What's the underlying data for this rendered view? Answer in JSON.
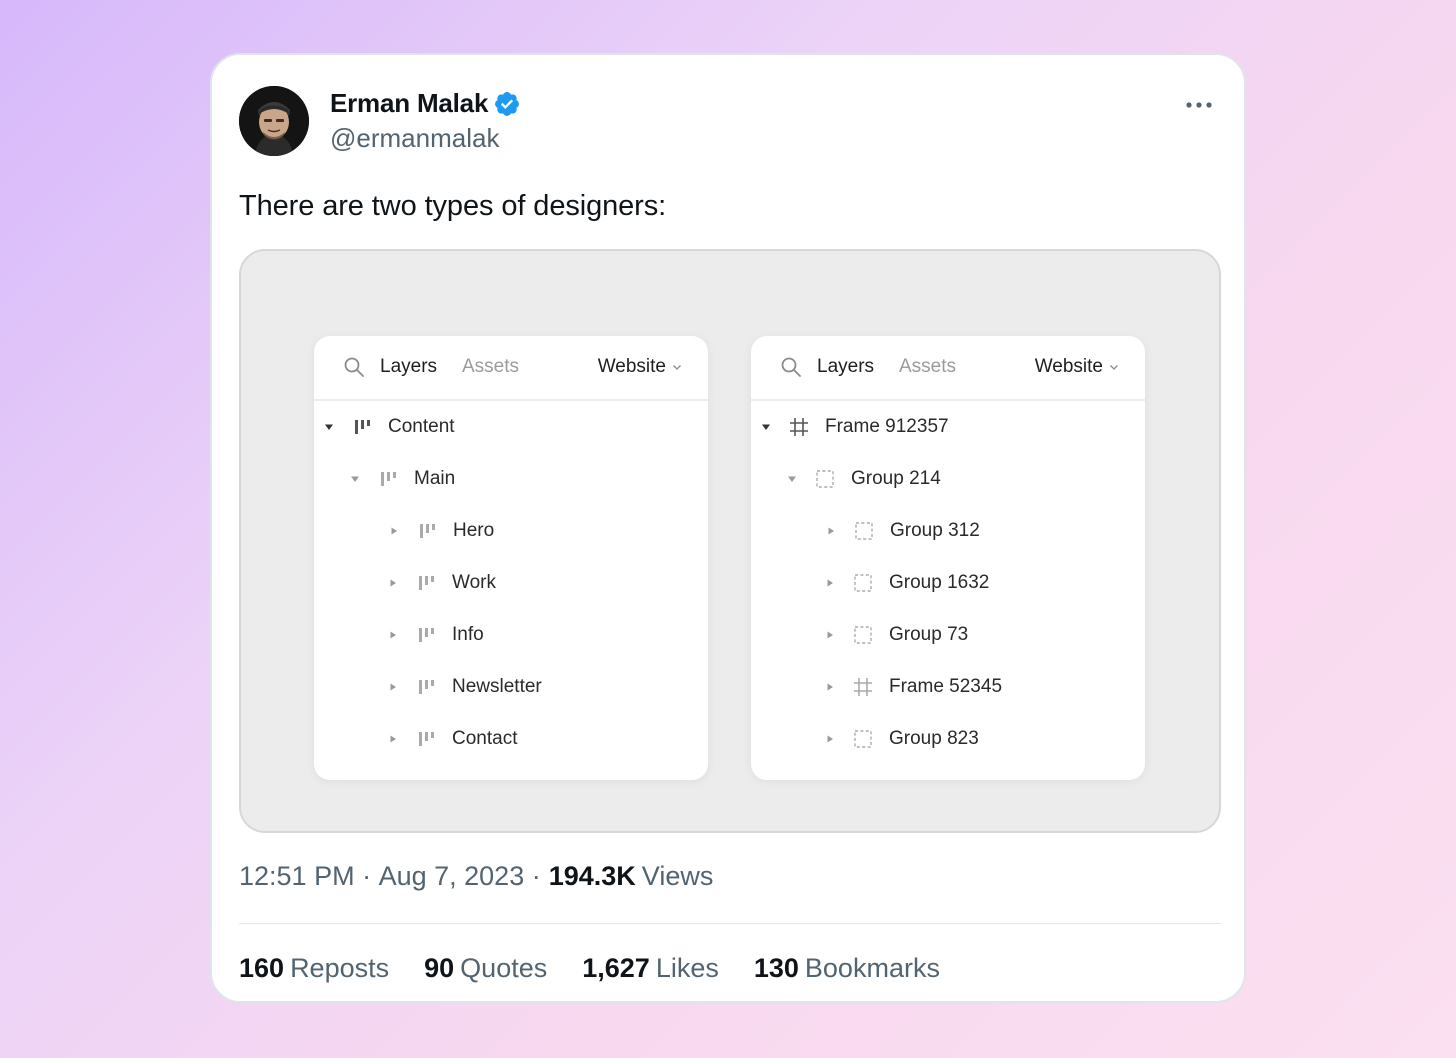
{
  "tweet": {
    "author_name": "Erman Malak",
    "handle": "@ermanmalak",
    "text": "There are two types of designers:",
    "time": "12:51 PM",
    "date": "Aug 7, 2023",
    "views_count": "194.3K",
    "views_label": "Views",
    "stats": [
      {
        "count": "160",
        "label": "Reposts"
      },
      {
        "count": "90",
        "label": "Quotes"
      },
      {
        "count": "1,627",
        "label": "Likes"
      },
      {
        "count": "130",
        "label": "Bookmarks"
      }
    ]
  },
  "panels": [
    {
      "tabs": {
        "layers": "Layers",
        "assets": "Assets",
        "page": "Website"
      },
      "rows": [
        {
          "label": "Content",
          "icon": "auto-layout-icon",
          "expanded": true
        },
        {
          "label": "Main",
          "icon": "auto-layout-icon",
          "expanded": true
        },
        {
          "label": "Hero",
          "icon": "auto-layout-icon",
          "expanded": false
        },
        {
          "label": "Work",
          "icon": "auto-layout-icon",
          "expanded": false
        },
        {
          "label": "Info",
          "icon": "auto-layout-icon",
          "expanded": false
        },
        {
          "label": "Newsletter",
          "icon": "auto-layout-icon",
          "expanded": false
        },
        {
          "label": "Contact",
          "icon": "auto-layout-icon",
          "expanded": false
        }
      ]
    },
    {
      "tabs": {
        "layers": "Layers",
        "assets": "Assets",
        "page": "Website"
      },
      "rows": [
        {
          "label": "Frame 912357",
          "icon": "frame-icon",
          "expanded": true
        },
        {
          "label": "Group 214",
          "icon": "group-icon",
          "expanded": true
        },
        {
          "label": "Group 312",
          "icon": "group-icon",
          "expanded": false
        },
        {
          "label": "Group 1632",
          "icon": "group-icon",
          "expanded": false
        },
        {
          "label": "Group 73",
          "icon": "group-icon",
          "expanded": false
        },
        {
          "label": "Frame 52345",
          "icon": "frame-icon",
          "expanded": false
        },
        {
          "label": "Group 823",
          "icon": "group-icon",
          "expanded": false
        }
      ]
    }
  ],
  "colors": {
    "verified": "#1d9bf0",
    "text_primary": "#0f1419",
    "text_secondary": "#536471"
  }
}
